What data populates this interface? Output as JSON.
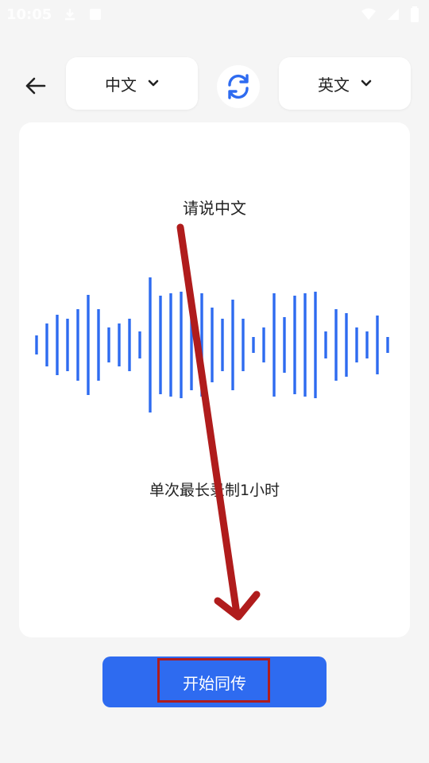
{
  "status_bar": {
    "time": "10:05"
  },
  "header": {
    "source_language": "中文",
    "target_language": "英文"
  },
  "card": {
    "prompt": "请说中文",
    "limit_note": "单次最长录制1小时",
    "waveform_bar_levels": [
      0.12,
      0.27,
      0.38,
      0.33,
      0.45,
      0.63,
      0.45,
      0.22,
      0.27,
      0.33,
      0.17,
      0.85,
      0.62,
      0.65,
      0.67,
      0.57,
      0.65,
      0.47,
      0.33,
      0.57,
      0.33,
      0.1,
      0.22,
      0.65,
      0.35,
      0.62,
      0.65,
      0.67,
      0.17,
      0.45,
      0.4,
      0.22,
      0.17,
      0.37,
      0.1
    ]
  },
  "actions": {
    "start_label": "开始同传"
  },
  "colors": {
    "accent": "#2e6bf0",
    "annotation": "#b01c1c"
  }
}
